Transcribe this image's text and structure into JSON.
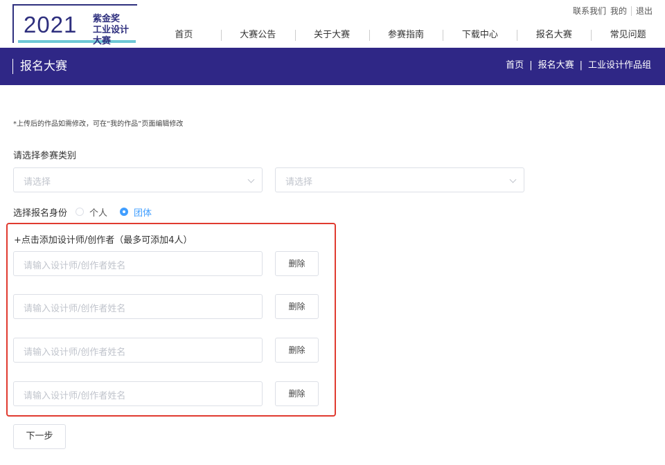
{
  "logo": {
    "year": "2021",
    "line1": "紫金奖",
    "line2": "工业设计大赛"
  },
  "top_links": [
    "联系我们",
    "我的",
    "退出"
  ],
  "nav": [
    "首页",
    "大赛公告",
    "关于大赛",
    "参赛指南",
    "下载中心",
    "报名大赛",
    "常见问题"
  ],
  "banner": {
    "title": "报名大赛",
    "breadcrumb": [
      "首页",
      "报名大赛",
      "工业设计作品组"
    ],
    "separator": "|"
  },
  "form": {
    "note": "*上传后的作品如需修改，可在“我的作品”页面编辑修改",
    "category_label": "请选择参赛类别",
    "select_placeholder_1": "请选择",
    "select_placeholder_2": "请选择",
    "identity_label": "选择报名身份",
    "identity_options": [
      {
        "label": "个人",
        "checked": false
      },
      {
        "label": "团体",
        "checked": true
      }
    ],
    "add_designer": "+点击添加设计师/创作者（最多可添加4人）",
    "designer_placeholder": "请输入设计师/创作者姓名",
    "delete_label": "删除",
    "next_label": "下一步"
  },
  "colors": {
    "banner_bg": "#2f2786",
    "accent": "#409eff",
    "highlight": "#e03a2f",
    "logo": "#2e2f7e"
  }
}
